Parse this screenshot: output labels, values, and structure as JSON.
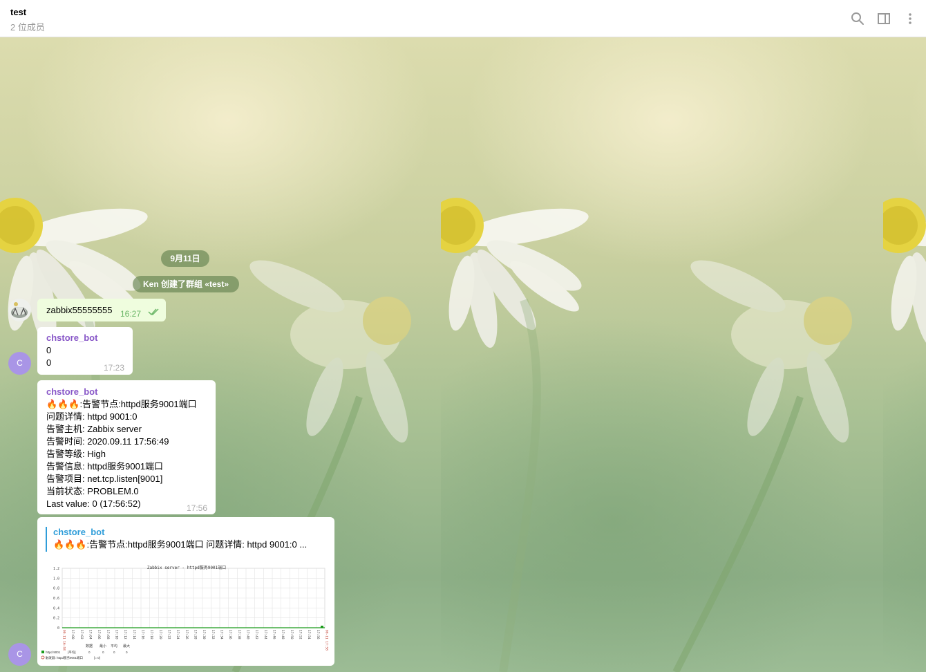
{
  "header": {
    "title": "test",
    "subtitle": "2 位成员",
    "icons": [
      "search-icon",
      "sidebar-toggle-icon",
      "more-vertical-icon"
    ]
  },
  "chat": {
    "date_separator": "9月11日",
    "service_message": "Ken 创建了群组 «test»",
    "messages": [
      {
        "type": "outgoing",
        "text": "zabbix55555555",
        "time": "16:27",
        "status": "read"
      },
      {
        "type": "incoming",
        "avatar_letter": "C",
        "sender": "chstore_bot",
        "lines": [
          "0",
          "0"
        ],
        "time": "17:23"
      },
      {
        "type": "incoming",
        "sender": "chstore_bot",
        "lines": [
          "🔥🔥🔥:告警节点:httpd服务9001端口",
          "问题详情:  httpd 9001:0",
          "告警主机:  Zabbix server",
          "告警时间:  2020.09.11 17:56:49",
          "告警等级:  High",
          "告警信息:  httpd服务9001端口",
          "告警项目:  net.tcp.listen[9001]",
          "当前状态:  PROBLEM.0",
          "Last value: 0 (17:56:52)"
        ],
        "time": "17:56"
      },
      {
        "type": "incoming-photo",
        "avatar_letter": "C",
        "reply_sender": "chstore_bot",
        "reply_text": "🔥🔥🔥:告警节点:httpd服务9001端口  问题详情:  httpd 9001:0 ..."
      }
    ]
  },
  "chart_data": {
    "type": "line",
    "title": "Zabbix server - httpd服务9001端口",
    "y_ticks": [
      "1.2",
      "1.0",
      "0.8",
      "0.6",
      "0.4",
      "0.2",
      "0"
    ],
    "ylim": [
      0,
      1.2
    ],
    "x_start_label": "09-11 16:58",
    "x_end_label": "09-11 17:58",
    "x_tick_labels": [
      "17:00",
      "17:02",
      "17:04",
      "17:06",
      "17:08",
      "17:10",
      "17:12",
      "17:14",
      "17:16",
      "17:18",
      "17:20",
      "17:22",
      "17:24",
      "17:26",
      "17:28",
      "17:30",
      "17:32",
      "17:34",
      "17:36",
      "17:38",
      "17:40",
      "17:42",
      "17:44",
      "17:46",
      "17:48",
      "17:50",
      "17:52",
      "17:54",
      "17:56"
    ],
    "series": [
      {
        "name": "httpd 9001",
        "values": [
          0,
          0
        ]
      }
    ],
    "legend_headers": [
      "数据",
      "最小",
      "平均",
      "最大"
    ],
    "legend_rows": [
      {
        "name": "httpd 9001",
        "scope": "[平均]",
        "last": "0",
        "min": "0",
        "avg": "0",
        "max": "0",
        "color": "#1a9a1a"
      },
      {
        "name": "触发器:  httpd服务9001端口",
        "scope": "[= 0]",
        "color": "#c0392b"
      }
    ],
    "grid": true
  },
  "colors": {
    "accent": "#2f9dd9",
    "sender": "#8857c8",
    "outgoing_bubble": "#effdde",
    "check": "#6cb768",
    "avatar": "#a995e6"
  }
}
